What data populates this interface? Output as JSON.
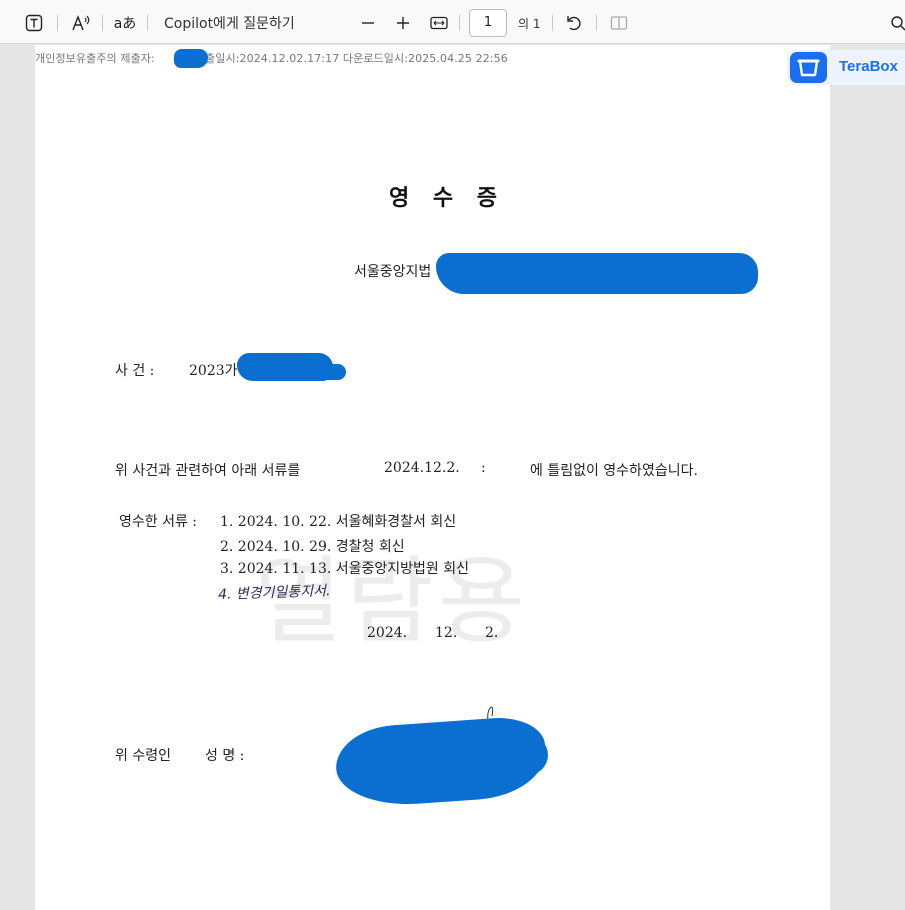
{
  "toolbar": {
    "copilot_label": "Copilot에게 질문하기",
    "page_input_value": "1",
    "page_total": "의 1",
    "text_icon_label": "aあ"
  },
  "document": {
    "meta_prefix": "개인정보유출주의 제출자:",
    "meta_suffix": "제출일시:2024.12.02.17:17 다운로드일시:2025.04.25 22:56",
    "title": "영 수 증",
    "court": "서울중앙지법",
    "case_label": "사     건 :",
    "case_value": "2023가",
    "body_line_prefix": "위 사건과 관련하여 아래 서류를",
    "body_date": "2024.12.2.",
    "body_colon": ":",
    "body_line_suffix": "에 틀림없이 영수하였습니다.",
    "docs_label": "영수한 서류 :",
    "doc_items": [
      "1. 2024. 10. 22. 서울혜화경찰서 회신",
      "2. 2024. 10. 29. 경찰청 회신",
      "3. 2024. 11. 13. 서울중앙지방법원 회신"
    ],
    "handwritten_item": "4. 변경기일통지서.",
    "date_year": "2024.",
    "date_month": "12.",
    "date_day": "2.",
    "recipient_label": "위 수령인",
    "recipient_name_label": "성     명 :",
    "watermark": "열람용"
  },
  "terabox": {
    "label": "TeraBox",
    "brand_color": "#1a6ff0"
  },
  "colors": {
    "redaction": "#0a6fd0"
  }
}
